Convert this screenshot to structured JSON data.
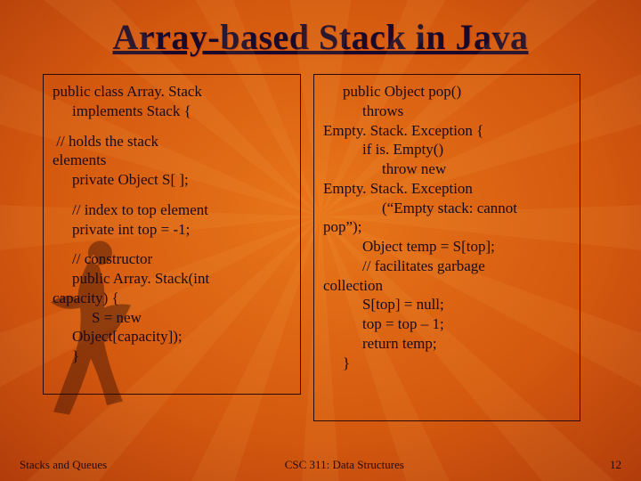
{
  "title": "Array-based Stack in Java",
  "left": {
    "l1": "public class Array. Stack",
    "l2": "implements Stack {",
    "l3": " // holds the stack",
    "l4": "elements",
    "l5": "private Object S[ ];",
    "l6": "// index to top element",
    "l7": "private int top = -1;",
    "l8": "// constructor",
    "l9": "public Array. Stack(int",
    "l10": "capacity) {",
    "l11": "S = new",
    "l12": "Object[capacity]);",
    "l13": "}"
  },
  "right": {
    "r1": "public Object pop()",
    "r2": "throws",
    "r3": "Empty. Stack. Exception {",
    "r4": "if is. Empty()",
    "r5": "throw new",
    "r6": "Empty. Stack. Exception",
    "r7": "(“Empty stack: cannot",
    "r8": "pop”);",
    "r9": "Object temp = S[top];",
    "r10": "// facilitates garbage",
    "r11": "collection",
    "r12": "S[top] = null;",
    "r13": "top = top – 1;",
    "r14": "return temp;",
    "r15": "}"
  },
  "footer": {
    "left": "Stacks and Queues",
    "center": "CSC 311: Data Structures",
    "right": "12"
  }
}
